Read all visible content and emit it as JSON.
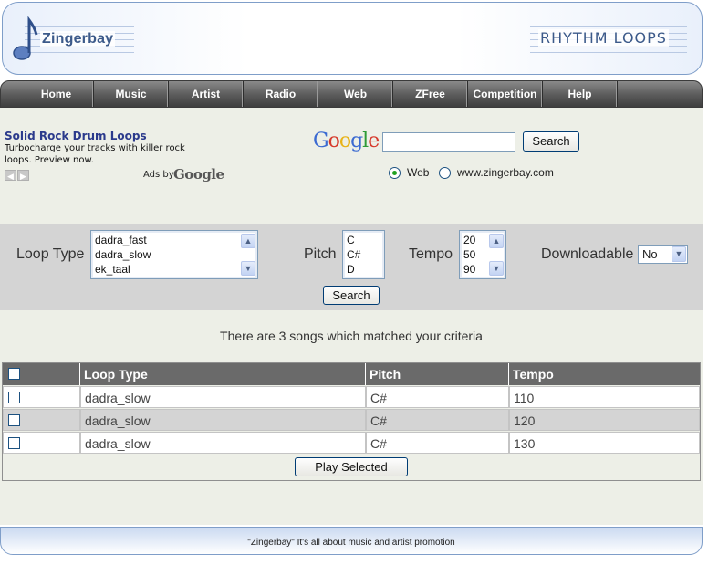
{
  "header": {
    "logo_text": "Zingerbay",
    "title": "RHYTHM LOOPS"
  },
  "nav": [
    "Home",
    "Music",
    "Artist",
    "Radio",
    "Web",
    "ZFree",
    "Competition",
    "Help"
  ],
  "ad": {
    "title": "Solid Rock Drum Loops",
    "description": "Turbocharge your tracks with killer rock loops. Preview now.",
    "ads_by": "Ads by",
    "ads_by_brand": "Google"
  },
  "google_search": {
    "logo": "Google",
    "input_value": "",
    "button": "Search",
    "options": [
      "Web",
      "www.zingerbay.com"
    ],
    "selected_option": "Web"
  },
  "filters": {
    "loop_type_label": "Loop Type",
    "loop_type_options": [
      "dadra_fast",
      "dadra_slow",
      "ek_taal"
    ],
    "pitch_label": "Pitch",
    "pitch_options": [
      "C",
      "C#",
      "D"
    ],
    "tempo_label": "Tempo",
    "tempo_options": [
      "20",
      "50",
      "90"
    ],
    "downloadable_label": "Downloadable",
    "downloadable_value": "No",
    "search_button": "Search"
  },
  "result_text": "There are 3 songs which matched your criteria",
  "table": {
    "headers": [
      "Loop Type",
      "Pitch",
      "Tempo"
    ],
    "rows": [
      {
        "loop_type": "dadra_slow",
        "pitch": "C#",
        "tempo": "110"
      },
      {
        "loop_type": "dadra_slow",
        "pitch": "C#",
        "tempo": "120"
      },
      {
        "loop_type": "dadra_slow",
        "pitch": "C#",
        "tempo": "130"
      }
    ],
    "play_button": "Play Selected"
  },
  "footer": "\"Zingerbay\" It's all about music and artist promotion"
}
